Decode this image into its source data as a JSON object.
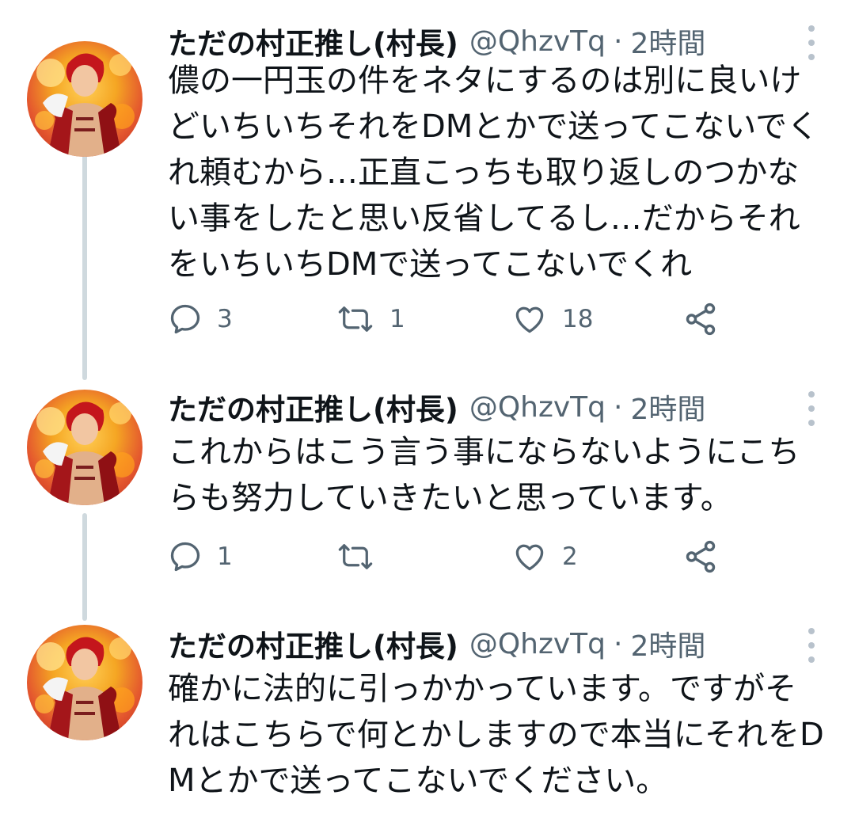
{
  "tweets": [
    {
      "name": "ただの村正推し(村長)",
      "handle": "@QhzvTq",
      "separator": "·",
      "time": "2時間",
      "text": "儂の一円玉の件をネタにするのは別に良いけどいちいちそれをDMとかで送ってこないでくれ頼むから…正直こっちも取り返しのつかない事をしたと思い反省してるし…だからそれをいちいちDMで送ってこないでくれ",
      "replies": "3",
      "retweets": "1",
      "likes": "18"
    },
    {
      "name": "ただの村正推し(村長)",
      "handle": "@QhzvTq",
      "separator": "·",
      "time": "2時間",
      "text": "これからはこう言う事にならないようにこちらも努力していきたいと思っています。",
      "replies": "1",
      "retweets": "",
      "likes": "2"
    },
    {
      "name": "ただの村正推し(村長)",
      "handle": "@QhzvTq",
      "separator": "·",
      "time": "2時間",
      "text": "確かに法的に引っかかっています。ですがそれはこちらで何とかしますので本当にそれをDMとかで送ってこないでください。"
    }
  ],
  "icons": {
    "reply": "reply-icon",
    "retweet": "retweet-icon",
    "like": "heart-icon",
    "share": "share-icon",
    "more": "more-vertical-icon"
  },
  "colors": {
    "text": "#0f1419",
    "secondary": "#536471",
    "thread_line": "#cfd9de"
  }
}
